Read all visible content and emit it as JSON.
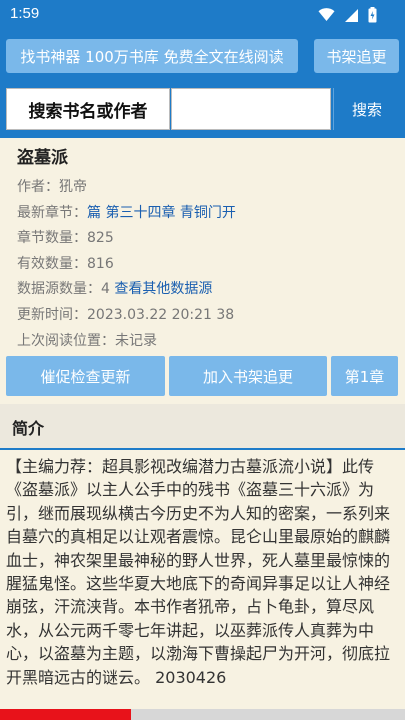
{
  "status": {
    "time": "1:59"
  },
  "top": {
    "banner": "找书神器 100万书库 免费全文在线阅读",
    "shelf_button": "书架追更"
  },
  "search": {
    "label": "搜索书名或作者",
    "placeholder": "",
    "button": "搜索"
  },
  "book": {
    "title": "盗墓派",
    "author_label": "作者：",
    "author": "犼帝",
    "latest_label": "最新章节：",
    "latest": "篇 第三十四章 青铜门开",
    "chapters_label": "章节数量：",
    "chapters": "825",
    "valid_label": "有效数量：",
    "valid": "816",
    "sources_label": "数据源数量：",
    "sources": "4",
    "sources_link": "查看其他数据源",
    "updated_label": "更新时间：",
    "updated": "2023.03.22 20:21 38",
    "lastread_label": "上次阅读位置：",
    "lastread": "未记录"
  },
  "actions": {
    "urge": "催促检查更新",
    "add": "加入书架追更",
    "first": "第1章"
  },
  "intro": {
    "heading": "简介",
    "text": "【主编力荐：超具影视改编潜力古墓派流小说】此传《盗墓派》以主人公手中的残书《盗墓三十六派》为引，继而展现纵横古今历史不为人知的密案，一系列来自墓穴的真相足以让观者震惊。昆仑山里最原始的麒麟血士，神农架里最神秘的野人世界，死人墓里最惊悚的腥猛鬼怪。这些华夏大地底下的奇闻异事足以让人神经崩弦，汗流浃背。本书作者犼帝，占卜龟卦，算尽风水，从公元两千零七年讲起，以巫葬派传人真葬为中心，以盗墓为主题，以渤海下曹操起尸为开河，彻底拉开黑暗远古的谜云。 2030426"
  },
  "colors": {
    "primary": "#1e7bc8",
    "button": "#7ab8ea",
    "link": "#1a5fb0",
    "background": "#f7f2e2",
    "accent": "#e8121a"
  }
}
